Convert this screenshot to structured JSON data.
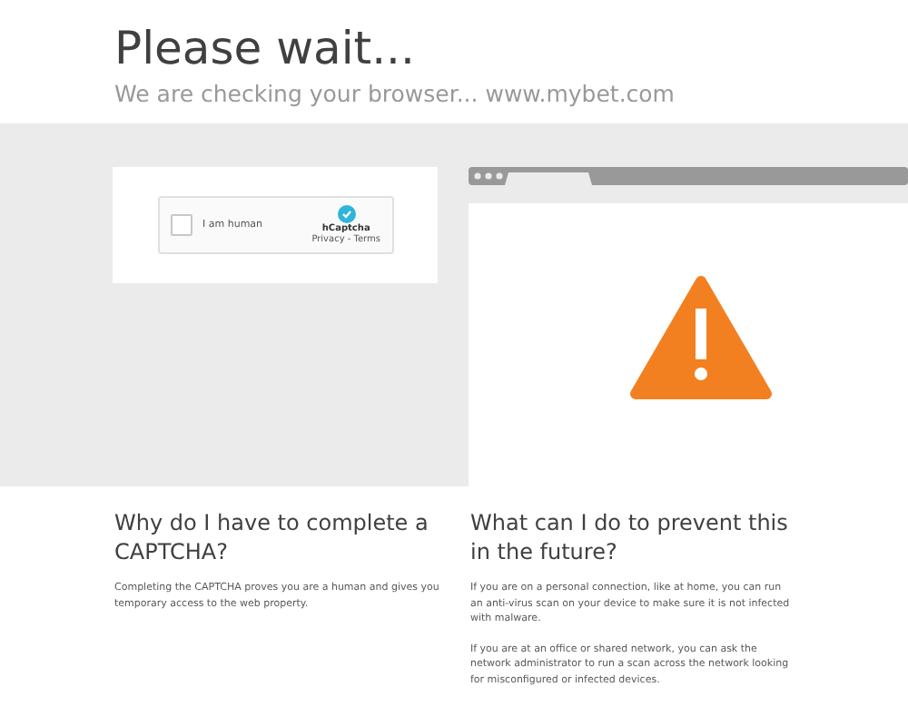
{
  "header": {
    "title": "Please wait...",
    "subtitle": "We are checking your browser... www.mybet.com"
  },
  "captcha": {
    "checked": false,
    "label": "I am human",
    "brand": "hCaptcha",
    "links": "Privacy - Terms"
  },
  "sections": [
    {
      "heading": "Why do I have to complete a CAPTCHA?",
      "paragraphs": [
        "Completing the CAPTCHA proves you are a human and gives you temporary access to the web property."
      ]
    },
    {
      "heading": "What can I do to prevent this in the future?",
      "paragraphs": [
        "If you are on a personal connection, like at home, you can run an anti-virus scan on your device to make sure it is not infected with malware.",
        "If you are at an office or shared network, you can ask the network administrator to run a scan across the network looking for misconfigured or infected devices."
      ]
    }
  ]
}
